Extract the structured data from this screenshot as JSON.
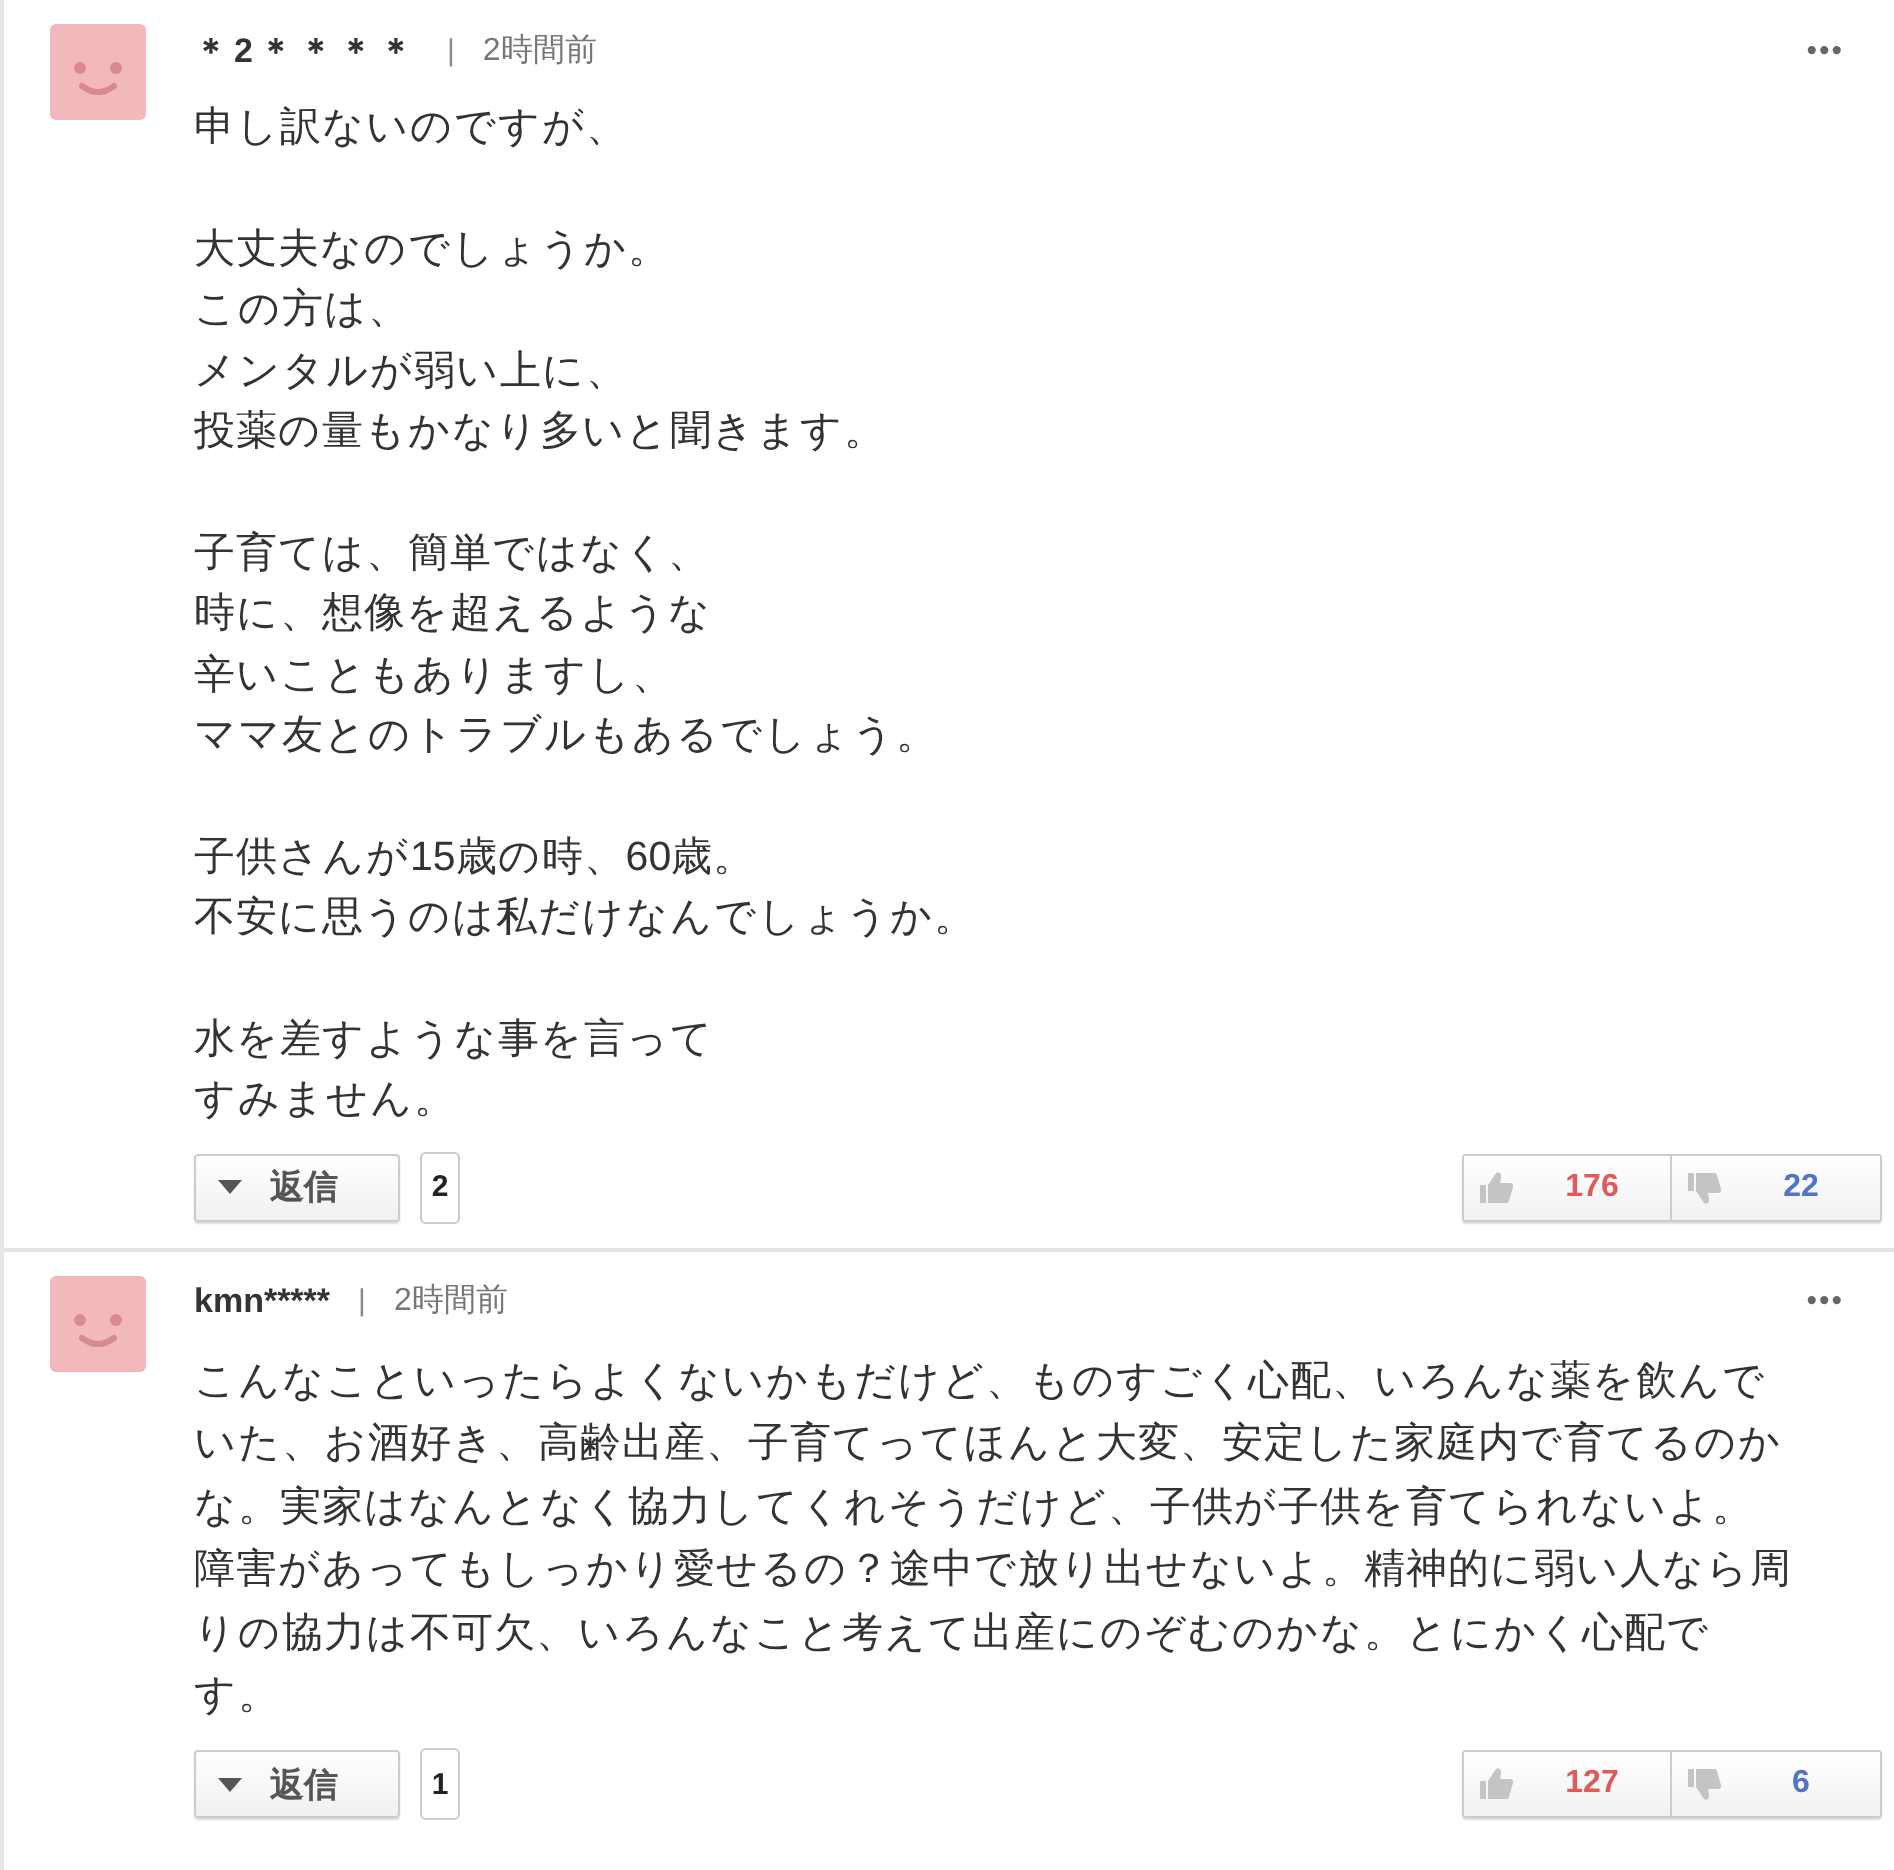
{
  "comments": [
    {
      "user": "＊2＊＊＊＊",
      "separator": "|",
      "time": "2時間前",
      "menu": "•••",
      "paragraphs": [
        [
          "申し訳ないのですが、"
        ],
        [
          "大丈夫なのでしょうか。",
          "この方は、",
          "メンタルが弱い上に、",
          "投薬の量もかなり多いと聞きます。"
        ],
        [
          "子育ては、簡単ではなく、",
          "時に、想像を超えるような",
          "辛いこともありますし、",
          "ママ友とのトラブルもあるでしょう。"
        ],
        [
          "子供さんが15歳の時、60歳。",
          "不安に思うのは私だけなんでしょうか。"
        ],
        [
          "水を差すような事を言って",
          "すみません。"
        ]
      ],
      "reply_label": "返信",
      "reply_count": "2",
      "likes": "176",
      "dislikes": "22"
    },
    {
      "user": "kmn*****",
      "separator": "|",
      "time": "2時間前",
      "menu": "•••",
      "paragraphs": [
        [
          "こんなこといったらよくないかもだけど、ものすごく心配、いろんな薬を飲んでいた、お酒好き、高齢出産、子育てってほんと大変、安定した家庭内で育てるのかな。実家はなんとなく協力してくれそうだけど、子供が子供を育てられないよ。障害があってもしっかり愛せるの？途中で放り出せないよ。精神的に弱い人なら周りの協力は不可欠、いろんなこと考えて出産にのぞむのかな。とにかく心配です。"
        ]
      ],
      "reply_label": "返信",
      "reply_count": "1",
      "likes": "127",
      "dislikes": "6"
    }
  ]
}
